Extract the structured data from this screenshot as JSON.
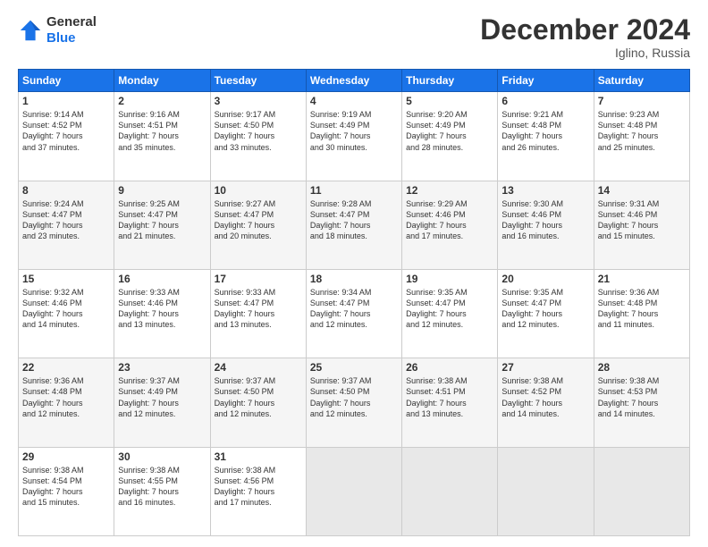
{
  "header": {
    "logo_line1": "General",
    "logo_line2": "Blue",
    "month": "December 2024",
    "location": "Iglino, Russia"
  },
  "weekdays": [
    "Sunday",
    "Monday",
    "Tuesday",
    "Wednesday",
    "Thursday",
    "Friday",
    "Saturday"
  ],
  "rows": [
    [
      {
        "day": "1",
        "text": "Sunrise: 9:14 AM\nSunset: 4:52 PM\nDaylight: 7 hours\nand 37 minutes."
      },
      {
        "day": "2",
        "text": "Sunrise: 9:16 AM\nSunset: 4:51 PM\nDaylight: 7 hours\nand 35 minutes."
      },
      {
        "day": "3",
        "text": "Sunrise: 9:17 AM\nSunset: 4:50 PM\nDaylight: 7 hours\nand 33 minutes."
      },
      {
        "day": "4",
        "text": "Sunrise: 9:19 AM\nSunset: 4:49 PM\nDaylight: 7 hours\nand 30 minutes."
      },
      {
        "day": "5",
        "text": "Sunrise: 9:20 AM\nSunset: 4:49 PM\nDaylight: 7 hours\nand 28 minutes."
      },
      {
        "day": "6",
        "text": "Sunrise: 9:21 AM\nSunset: 4:48 PM\nDaylight: 7 hours\nand 26 minutes."
      },
      {
        "day": "7",
        "text": "Sunrise: 9:23 AM\nSunset: 4:48 PM\nDaylight: 7 hours\nand 25 minutes."
      }
    ],
    [
      {
        "day": "8",
        "text": "Sunrise: 9:24 AM\nSunset: 4:47 PM\nDaylight: 7 hours\nand 23 minutes."
      },
      {
        "day": "9",
        "text": "Sunrise: 9:25 AM\nSunset: 4:47 PM\nDaylight: 7 hours\nand 21 minutes."
      },
      {
        "day": "10",
        "text": "Sunrise: 9:27 AM\nSunset: 4:47 PM\nDaylight: 7 hours\nand 20 minutes."
      },
      {
        "day": "11",
        "text": "Sunrise: 9:28 AM\nSunset: 4:47 PM\nDaylight: 7 hours\nand 18 minutes."
      },
      {
        "day": "12",
        "text": "Sunrise: 9:29 AM\nSunset: 4:46 PM\nDaylight: 7 hours\nand 17 minutes."
      },
      {
        "day": "13",
        "text": "Sunrise: 9:30 AM\nSunset: 4:46 PM\nDaylight: 7 hours\nand 16 minutes."
      },
      {
        "day": "14",
        "text": "Sunrise: 9:31 AM\nSunset: 4:46 PM\nDaylight: 7 hours\nand 15 minutes."
      }
    ],
    [
      {
        "day": "15",
        "text": "Sunrise: 9:32 AM\nSunset: 4:46 PM\nDaylight: 7 hours\nand 14 minutes."
      },
      {
        "day": "16",
        "text": "Sunrise: 9:33 AM\nSunset: 4:46 PM\nDaylight: 7 hours\nand 13 minutes."
      },
      {
        "day": "17",
        "text": "Sunrise: 9:33 AM\nSunset: 4:47 PM\nDaylight: 7 hours\nand 13 minutes."
      },
      {
        "day": "18",
        "text": "Sunrise: 9:34 AM\nSunset: 4:47 PM\nDaylight: 7 hours\nand 12 minutes."
      },
      {
        "day": "19",
        "text": "Sunrise: 9:35 AM\nSunset: 4:47 PM\nDaylight: 7 hours\nand 12 minutes."
      },
      {
        "day": "20",
        "text": "Sunrise: 9:35 AM\nSunset: 4:47 PM\nDaylight: 7 hours\nand 12 minutes."
      },
      {
        "day": "21",
        "text": "Sunrise: 9:36 AM\nSunset: 4:48 PM\nDaylight: 7 hours\nand 11 minutes."
      }
    ],
    [
      {
        "day": "22",
        "text": "Sunrise: 9:36 AM\nSunset: 4:48 PM\nDaylight: 7 hours\nand 12 minutes."
      },
      {
        "day": "23",
        "text": "Sunrise: 9:37 AM\nSunset: 4:49 PM\nDaylight: 7 hours\nand 12 minutes."
      },
      {
        "day": "24",
        "text": "Sunrise: 9:37 AM\nSunset: 4:50 PM\nDaylight: 7 hours\nand 12 minutes."
      },
      {
        "day": "25",
        "text": "Sunrise: 9:37 AM\nSunset: 4:50 PM\nDaylight: 7 hours\nand 12 minutes."
      },
      {
        "day": "26",
        "text": "Sunrise: 9:38 AM\nSunset: 4:51 PM\nDaylight: 7 hours\nand 13 minutes."
      },
      {
        "day": "27",
        "text": "Sunrise: 9:38 AM\nSunset: 4:52 PM\nDaylight: 7 hours\nand 14 minutes."
      },
      {
        "day": "28",
        "text": "Sunrise: 9:38 AM\nSunset: 4:53 PM\nDaylight: 7 hours\nand 14 minutes."
      }
    ],
    [
      {
        "day": "29",
        "text": "Sunrise: 9:38 AM\nSunset: 4:54 PM\nDaylight: 7 hours\nand 15 minutes."
      },
      {
        "day": "30",
        "text": "Sunrise: 9:38 AM\nSunset: 4:55 PM\nDaylight: 7 hours\nand 16 minutes."
      },
      {
        "day": "31",
        "text": "Sunrise: 9:38 AM\nSunset: 4:56 PM\nDaylight: 7 hours\nand 17 minutes."
      },
      {
        "day": "",
        "text": ""
      },
      {
        "day": "",
        "text": ""
      },
      {
        "day": "",
        "text": ""
      },
      {
        "day": "",
        "text": ""
      }
    ]
  ]
}
